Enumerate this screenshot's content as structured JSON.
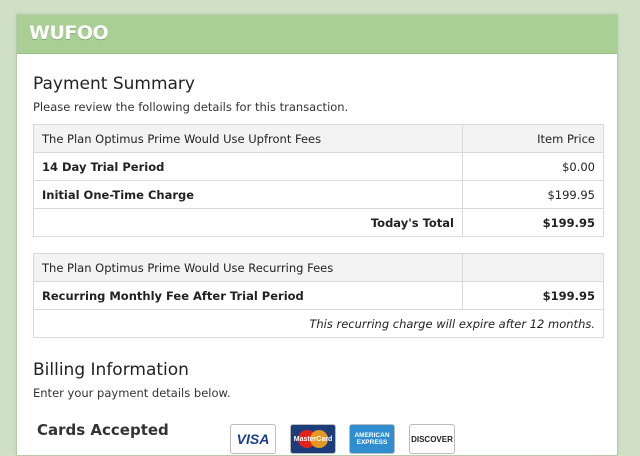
{
  "brand": {
    "logo_text": "WUFOO"
  },
  "payment_summary": {
    "title": "Payment Summary",
    "description": "Please review the following details for this transaction."
  },
  "upfront_table": {
    "header": {
      "label": "The Plan Optimus Prime Would Use Upfront Fees",
      "price_label": "Item Price"
    },
    "rows": [
      {
        "label": "14 Day Trial Period",
        "price": "$0.00"
      },
      {
        "label": "Initial One-Time Charge",
        "price": "$199.95"
      }
    ],
    "total": {
      "label": "Today's Total",
      "price": "$199.95"
    }
  },
  "recurring_table": {
    "header": {
      "label": "The Plan Optimus Prime Would Use Recurring Fees",
      "price_label": ""
    },
    "rows": [
      {
        "label": "Recurring Monthly Fee After Trial Period",
        "price": "$199.95"
      }
    ],
    "note": "This recurring charge will expire after 12 months."
  },
  "billing": {
    "title": "Billing Information",
    "description": "Enter your payment details below."
  },
  "cards": {
    "title": "Cards Accepted",
    "items": [
      {
        "name": "VISA",
        "icon": "visa-card-icon"
      },
      {
        "name": "MasterCard",
        "icon": "mastercard-card-icon"
      },
      {
        "name": "AMERICAN EXPRESS",
        "icon": "amex-card-icon"
      },
      {
        "name": "DISCOVER",
        "icon": "discover-card-icon"
      }
    ]
  },
  "colors": {
    "header_bg": "#a9cf94",
    "page_bg": "#cfe0c5"
  }
}
